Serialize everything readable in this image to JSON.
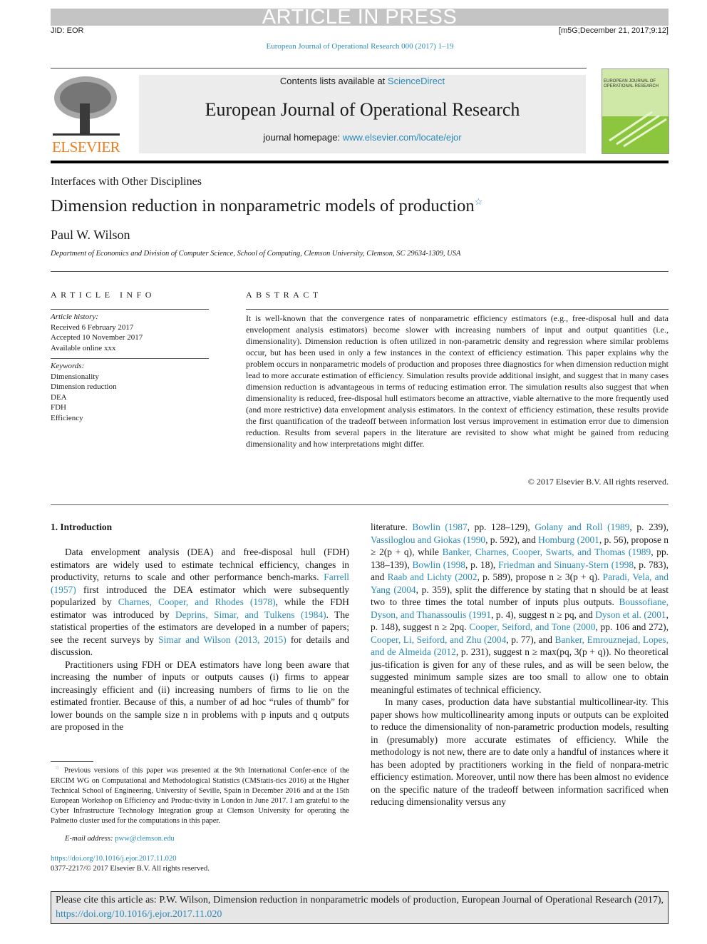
{
  "banner": "ARTICLE IN PRESS",
  "jid": "JID: EOR",
  "stamp": "[m5G;December 21, 2017;9:12]",
  "journal_ref": "European Journal of Operational Research 000 (2017) 1–19",
  "header": {
    "contents_prefix": "Contents lists available at ",
    "contents_link": "ScienceDirect",
    "journal_title": "European Journal of Operational Research",
    "homepage_prefix": "journal homepage: ",
    "homepage_link": "www.elsevier.com/locate/ejor",
    "publisher_logo": "ELSEVIER",
    "cover_title": "EUROPEAN JOURNAL OF OPERATIONAL RESEARCH"
  },
  "section": "Interfaces with Other Disciplines",
  "title": "Dimension reduction in nonparametric models of production",
  "title_mark": "☆",
  "author": "Paul W. Wilson",
  "affiliation": "Department of Economics and Division of Computer Science, School of Computing, Clemson University, Clemson, SC 29634-1309, USA",
  "article_info": {
    "heading": "ARTICLE INFO",
    "history_label": "Article history:",
    "history": [
      "Received 6 February 2017",
      "Accepted 10 November 2017",
      "Available online xxx"
    ],
    "keywords_label": "Keywords:",
    "keywords": [
      "Dimensionality",
      "Dimension reduction",
      "DEA",
      "FDH",
      "Efficiency"
    ]
  },
  "abstract": {
    "heading": "ABSTRACT",
    "text": "It is well-known that the convergence rates of nonparametric efficiency estimators (e.g., free-disposal hull and data envelopment analysis estimators) become slower with increasing numbers of input and output quantities (i.e., dimensionality). Dimension reduction is often utilized in non-parametric density and regression where similar problems occur, but has been used in only a few instances in the context of efficiency estimation. This paper explains why the problem occurs in nonparametric models of production and proposes three diagnostics for when dimension reduction might lead to more accurate estimation of efficiency. Simulation results provide additional insight, and suggest that in many cases dimension reduction is advantageous in terms of reducing estimation error. The simulation results also suggest that when dimensionality is reduced, free-disposal hull estimators become an attractive, viable alternative to the more frequently used (and more restrictive) data envelopment analysis estimators. In the context of efficiency estimation, these results provide the first quantification of the tradeoff between information lost versus improvement in estimation error due to dimension reduction. Results from several papers in the literature are revisited to show what might be gained from reducing dimensionality and how interpretations might differ.",
    "copyright": "© 2017 Elsevier B.V. All rights reserved."
  },
  "intro_heading": "1.  Introduction",
  "left_paragraphs": [
    [
      {
        "t": "Data envelopment analysis (DEA) and free-disposal hull (FDH) estimators are widely used to estimate technical efficiency, changes in productivity, returns to scale and other performance bench-marks. "
      },
      {
        "t": "Farrell (1957)",
        "l": 1
      },
      {
        "t": " first introduced the DEA estimator which were subsequently popularized by "
      },
      {
        "t": "Charnes, Cooper, and Rhodes (1978)",
        "l": 1
      },
      {
        "t": ", while the FDH estimator was introduced by "
      },
      {
        "t": "Deprins, Simar, and Tulkens (1984)",
        "l": 1
      },
      {
        "t": ". The statistical properties of the estimators are developed in a number of papers; see the recent surveys by "
      },
      {
        "t": "Simar and Wilson (2013, 2015)",
        "l": 1
      },
      {
        "t": " for details and discussion."
      }
    ],
    [
      {
        "t": "Practitioners using FDH or DEA estimators have long been aware that increasing the number of inputs or outputs causes (i) firms to appear increasingly efficient and (ii) increasing numbers of firms to lie on the estimated frontier. Because of this, a number of ad hoc “rules of thumb” for lower bounds on the sample size n in problems with p inputs and q outputs are proposed in the"
      }
    ]
  ],
  "right_paragraphs": [
    [
      {
        "t": "literature. "
      },
      {
        "t": "Bowlin (1987",
        "l": 1
      },
      {
        "t": ", pp. 128–129), "
      },
      {
        "t": "Golany and Roll (1989",
        "l": 1
      },
      {
        "t": ", p. 239), "
      },
      {
        "t": "Vassiloglou and Giokas (1990",
        "l": 1
      },
      {
        "t": ", p. 592), and "
      },
      {
        "t": "Homburg (2001",
        "l": 1
      },
      {
        "t": ", p. 56), propose n ≥ 2(p + q), while "
      },
      {
        "t": "Banker, Charnes, Cooper, Swarts, and Thomas (1989",
        "l": 1
      },
      {
        "t": ", pp. 138–139), "
      },
      {
        "t": "Bowlin (1998",
        "l": 1
      },
      {
        "t": ", p. 18), "
      },
      {
        "t": "Friedman and Sinuany-Stern (1998",
        "l": 1
      },
      {
        "t": ", p. 783), and "
      },
      {
        "t": "Raab and Lichty (2002",
        "l": 1
      },
      {
        "t": ", p. 589), propose n ≥ 3(p + q). "
      },
      {
        "t": "Paradi, Vela, and Yang (2004",
        "l": 1
      },
      {
        "t": ", p. 359), split the difference by stating that n should be at least two to three times the total number of inputs plus outputs. "
      },
      {
        "t": "Boussofiane, Dyson, and Thanassoulis (1991",
        "l": 1
      },
      {
        "t": ", p. 4), suggest n ≥ pq, and "
      },
      {
        "t": "Dyson et al. (2001",
        "l": 1
      },
      {
        "t": ", p. 148), suggest n ≥ 2pq. "
      },
      {
        "t": "Cooper, Seiford, and Tone (2000",
        "l": 1
      },
      {
        "t": ", pp. 106 and 272), "
      },
      {
        "t": "Cooper, Li, Seiford, and Zhu (2004",
        "l": 1
      },
      {
        "t": ", p. 77), and "
      },
      {
        "t": "Banker, Emrouznejad, Lopes, and de Almeida (2012",
        "l": 1
      },
      {
        "t": ", p. 231), suggest n ≥ max(pq, 3(p + q)). No theoretical jus-tification is given for any of these rules, and as will be seen below, the suggested minimum sample sizes are too small to allow one to obtain meaningful estimates of technical efficiency."
      }
    ],
    [
      {
        "t": "In many cases, production data have substantial multicollinear-ity. This paper shows how multicollinearity among inputs or outputs can be exploited to reduce the dimensionality of non-parametric production models, resulting in (presumably) more accurate estimates of efficiency. While the methodology is not new, there are to date only a handful of instances where it has been adopted by practitioners working in the field of nonpara-metric efficiency estimation. Moreover, until now there has been almost no evidence on the specific nature of the tradeoff between information sacrificed when reducing dimensionality versus any"
      }
    ]
  ],
  "footnote": {
    "mark": "☆",
    "text": "Previous versions of this paper was presented at the 9th International Confer-ence of the ERCIM WG on Computational and Methodological Statistics (CMStatis-tics 2016) at the Higher Technical School of Engineering, University of Seville, Spain in December 2016 and at the 15th European Workshop on Efficiency and Produc-tivity in London in June 2017. I am grateful to the Cyber Infrastructure Technology Integration group at Clemson University for operating the Palmetto cluster used for the computations in this paper.",
    "email_label": "E-mail address: ",
    "email": "pww@clemson.edu"
  },
  "doi": "https://doi.org/10.1016/j.ejor.2017.11.020",
  "issn": "0377-2217/© 2017 Elsevier B.V. All rights reserved.",
  "cite": {
    "prefix": "Please cite this article as: P.W. Wilson, Dimension reduction in nonparametric models of production, European Journal of Operational Research (2017), ",
    "doi": "https://doi.org/10.1016/j.ejor.2017.11.020"
  },
  "colors": {
    "link": "#2a8ab8",
    "banner": "#c4c4c4",
    "elsevier": "#f07f1a",
    "cover": "#8cc63f"
  }
}
